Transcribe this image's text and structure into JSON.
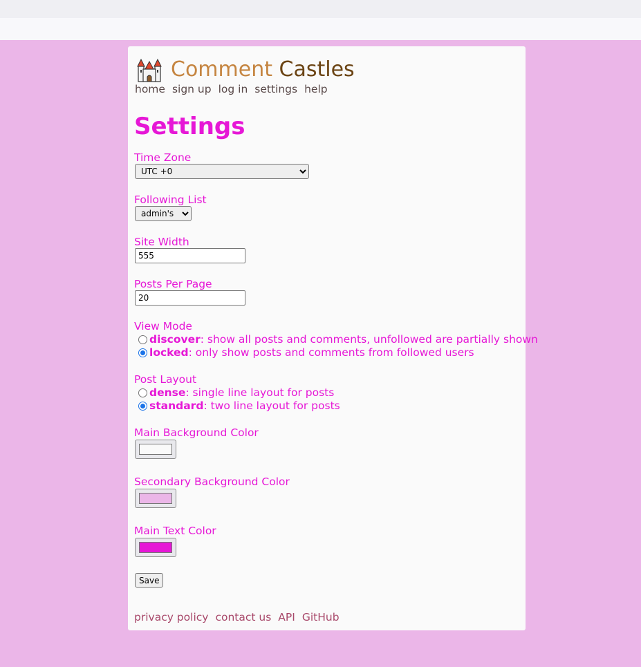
{
  "brand": {
    "title_part1": "Comment",
    "title_part2": "Castles",
    "logo_icon": "castle-icon"
  },
  "nav": [
    "home",
    "sign up",
    "log in",
    "settings",
    "help"
  ],
  "page_title": "Settings",
  "timezone": {
    "label": "Time Zone",
    "value": "UTC +0"
  },
  "following": {
    "label": "Following List",
    "value": "admin's"
  },
  "site_width": {
    "label": "Site Width",
    "value": "555"
  },
  "posts_per_page": {
    "label": "Posts Per Page",
    "value": "20"
  },
  "view_mode": {
    "label": "View Mode",
    "options": [
      {
        "key": "discover",
        "desc": ": show all posts and comments, unfollowed are partially shown",
        "checked": false
      },
      {
        "key": "locked",
        "desc": ": only show posts and comments from followed users",
        "checked": true
      }
    ]
  },
  "post_layout": {
    "label": "Post Layout",
    "options": [
      {
        "key": "dense",
        "desc": ": single line layout for posts",
        "checked": false
      },
      {
        "key": "standard",
        "desc": ": two line layout for posts",
        "checked": true
      }
    ]
  },
  "colors": {
    "main_bg": {
      "label": "Main Background Color",
      "value": "#fafafa"
    },
    "secondary_bg": {
      "label": "Secondary Background Color",
      "value": "#ebb6e8"
    },
    "main_text": {
      "label": "Main Text Color",
      "value": "#e617d6"
    }
  },
  "save_label": "Save",
  "footer": [
    "privacy policy",
    "contact us",
    "API",
    "GitHub"
  ]
}
